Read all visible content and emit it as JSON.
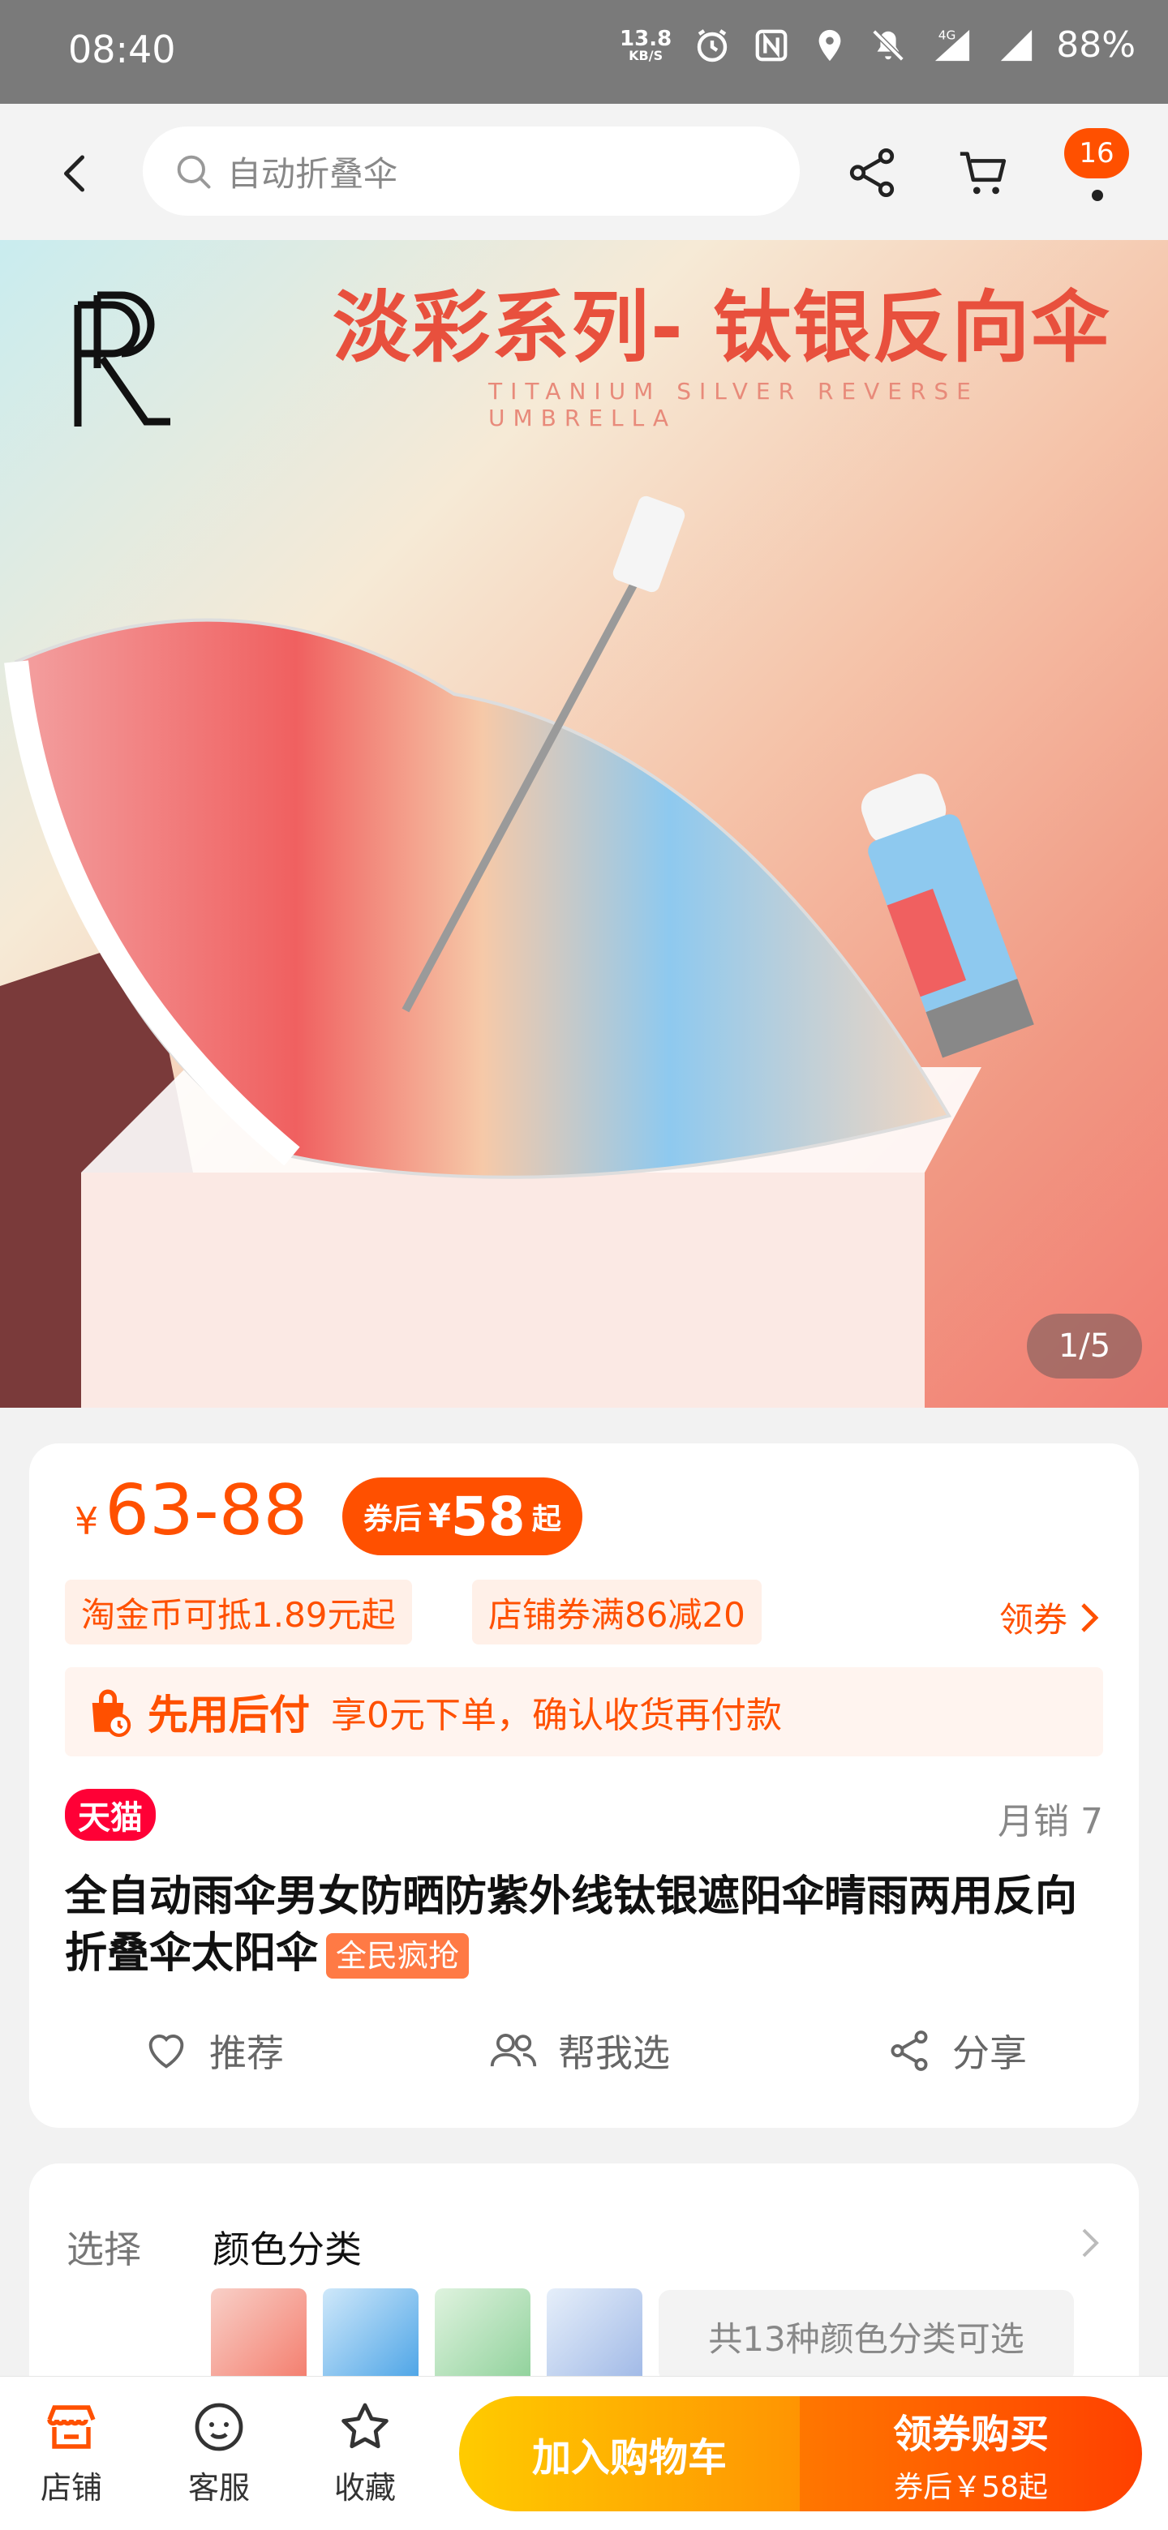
{
  "status_bar": {
    "time": "08:40",
    "net_speed": "13.8",
    "net_unit": "KB/S",
    "network": "4G",
    "battery": "88%"
  },
  "nav": {
    "search_placeholder": "自动折叠伞",
    "cart_badge": "16"
  },
  "hero": {
    "title": "淡彩系列- 钛银反向伞",
    "subtitle": "TITANIUM SILVER REVERSE UMBRELLA",
    "pager": "1/5"
  },
  "product": {
    "currency": "¥",
    "price_range": "63-88",
    "coupon_prefix": "券后",
    "coupon_currency": "¥",
    "coupon_price": "58",
    "coupon_suffix": "起",
    "tags": [
      "淘金币可抵1.89元起",
      "店铺券满86减20"
    ],
    "coupon_link": "领券",
    "paylater_title": "先用后付",
    "paylater_desc": "享0元下单，确认收货再付款",
    "store_badge": "天猫",
    "monthly_sales": "月销 7",
    "title": "全自动雨伞男女防晒防紫外线钛银遮阳伞晴雨两用反向折叠伞太阳伞",
    "hot_tag": "全民疯抢",
    "actions": [
      "推荐",
      "帮我选",
      "分享"
    ]
  },
  "spec": {
    "label": "选择",
    "name": "颜色分类",
    "more": "共13种颜色分类可选"
  },
  "bottom": {
    "store": "店铺",
    "service": "客服",
    "favorite": "收藏",
    "add_cart": "加入购物车",
    "buy": "领券购买",
    "buy_sub": "券后￥58起"
  },
  "colors": {
    "accent": "#ff5000",
    "tmall": "#ff0036"
  }
}
